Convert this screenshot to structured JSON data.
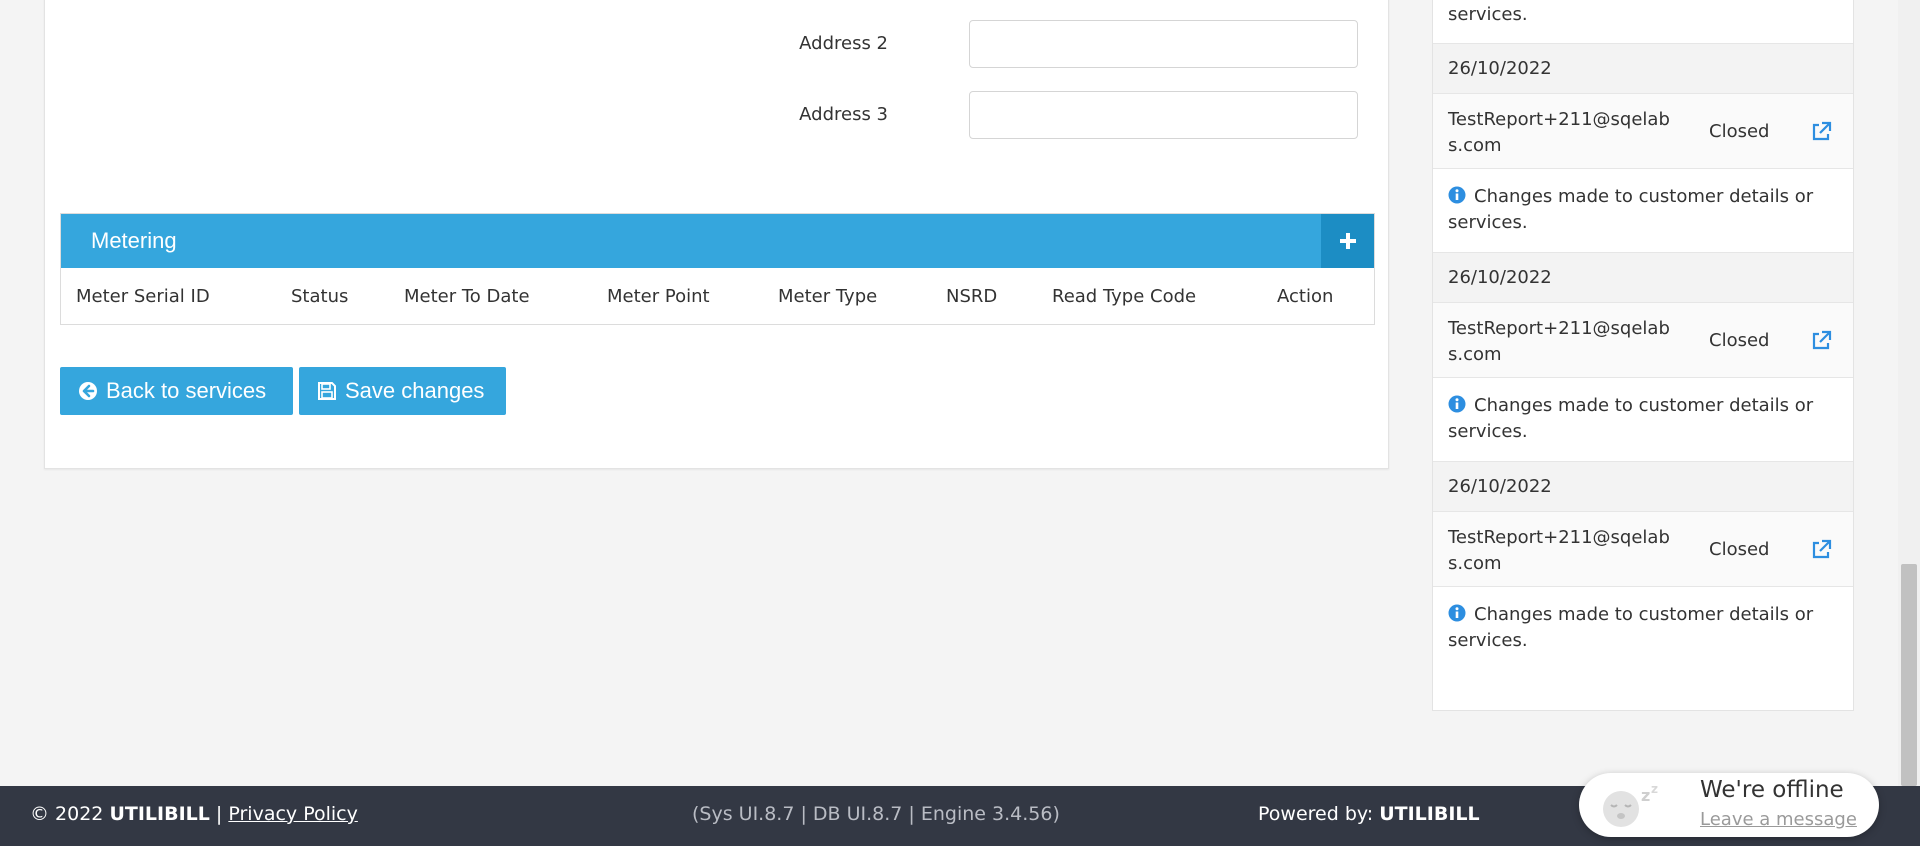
{
  "form": {
    "address2_label": "Address 2",
    "address2_value": "",
    "address3_label": "Address 3",
    "address3_value": ""
  },
  "metering": {
    "title": "Metering",
    "add_icon": "plus-icon",
    "columns": [
      "Meter Serial ID",
      "Status",
      "Meter To Date",
      "Meter Point",
      "Meter Type",
      "NSRD",
      "Read Type Code",
      "Action"
    ]
  },
  "buttons": {
    "back_label": "Back to services",
    "back_icon": "arrow-circle-left-icon",
    "save_label": "Save changes",
    "save_icon": "floppy-disk-icon"
  },
  "activity": {
    "top_partial_text": "services.",
    "items": [
      {
        "date": "26/10/2022",
        "email": "TestReport+211@sqelabs.com",
        "status": "Closed",
        "note": "Changes made to customer details or services."
      },
      {
        "date": "26/10/2022",
        "email": "TestReport+211@sqelabs.com",
        "status": "Closed",
        "note": "Changes made to customer details or services."
      },
      {
        "date": "26/10/2022",
        "email": "TestReport+211@sqelabs.com",
        "status": "Closed",
        "note": "Changes made to customer details or services."
      }
    ]
  },
  "footer": {
    "copyright": "© 2022",
    "brand": "UTILIBILL",
    "separator": "|",
    "privacy_link": "Privacy Policy",
    "versions": "(Sys UI.8.7 | DB UI.8.7 | Engine 3.4.56)",
    "powered_by": "Powered by:",
    "powered_brand": "UTILIBILL"
  },
  "chat": {
    "title": "We're offline",
    "link": "Leave a message"
  },
  "colors": {
    "accent": "#35a6dd",
    "accent_dark": "#1c8dc4",
    "footer_bg": "#333844",
    "info_blue": "#2d8ee0"
  }
}
